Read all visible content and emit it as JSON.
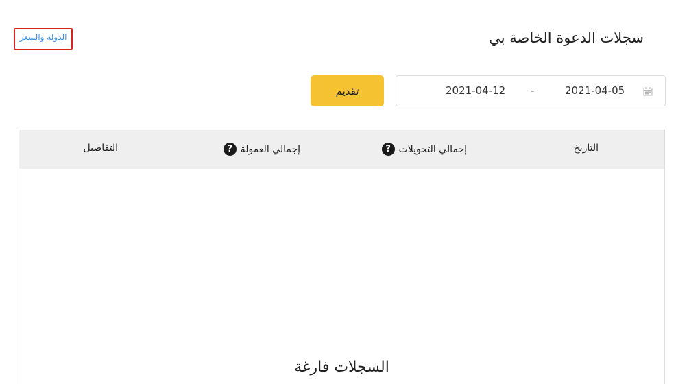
{
  "header": {
    "title": "سجلات الدعوة الخاصة بي",
    "country_price_link": "الدولة والسعر"
  },
  "filters": {
    "start_date": "2021-04-05",
    "separator": "-",
    "end_date": "2021-04-12",
    "submit_label": "تقديم",
    "calendar_icon": "calendar-icon"
  },
  "table": {
    "columns": {
      "date": "التاريخ",
      "total_conversions": "إجمالي التحويلات",
      "total_commission": "إجمالي العمولة",
      "details": "التفاصيل"
    },
    "help_icon_glyph": "?",
    "empty_message": "السجلات فارغة"
  },
  "colors": {
    "accent_button": "#f5c232",
    "link": "#3a8ee6",
    "highlight_border": "#d9261c",
    "header_bg": "#efefef"
  }
}
